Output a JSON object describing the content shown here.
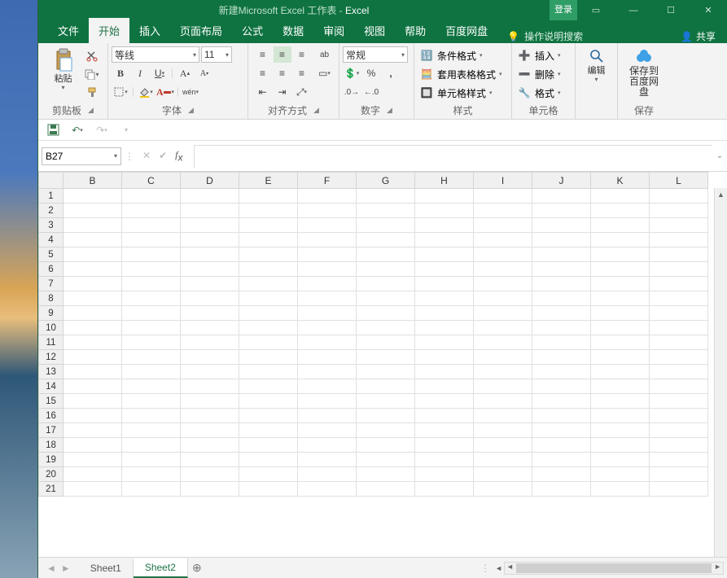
{
  "window": {
    "doc_title": "新建Microsoft Excel 工作表",
    "sep": " - ",
    "app_name": "Excel",
    "login": "登录",
    "share": "共享"
  },
  "tabs": {
    "file": "文件",
    "home": "开始",
    "insert": "插入",
    "layout": "页面布局",
    "formulas": "公式",
    "data": "数据",
    "review": "审阅",
    "view": "视图",
    "help": "帮助",
    "baidu": "百度网盘",
    "tellme": "操作说明搜索"
  },
  "ribbon": {
    "clipboard": {
      "label": "剪贴板",
      "paste": "粘贴"
    },
    "font": {
      "label": "字体",
      "name": "等线",
      "size": "11",
      "bold": "B",
      "italic": "I",
      "underline": "U",
      "ruby": "wén"
    },
    "align": {
      "label": "对齐方式",
      "wrap": "ab"
    },
    "number": {
      "label": "数字",
      "format": "常规"
    },
    "styles": {
      "label": "样式",
      "cond": "条件格式",
      "table": "套用表格格式",
      "cell": "单元格样式"
    },
    "cells": {
      "label": "单元格",
      "insert": "插入",
      "delete": "删除",
      "format": "格式"
    },
    "editing": {
      "label": "编辑",
      "btn": "编辑"
    },
    "baidu": {
      "label": "保存",
      "btn1": "保存到",
      "btn2": "百度网盘"
    }
  },
  "cellref": "B27",
  "columns": [
    "B",
    "C",
    "D",
    "E",
    "F",
    "G",
    "H",
    "I",
    "J",
    "K",
    "L"
  ],
  "rows": [
    "1",
    "2",
    "3",
    "4",
    "5",
    "6",
    "7",
    "8",
    "9",
    "10",
    "11",
    "12",
    "13",
    "14",
    "15",
    "16",
    "17",
    "18",
    "19",
    "20",
    "21"
  ],
  "sheets": {
    "s1": "Sheet1",
    "s2": "Sheet2"
  }
}
